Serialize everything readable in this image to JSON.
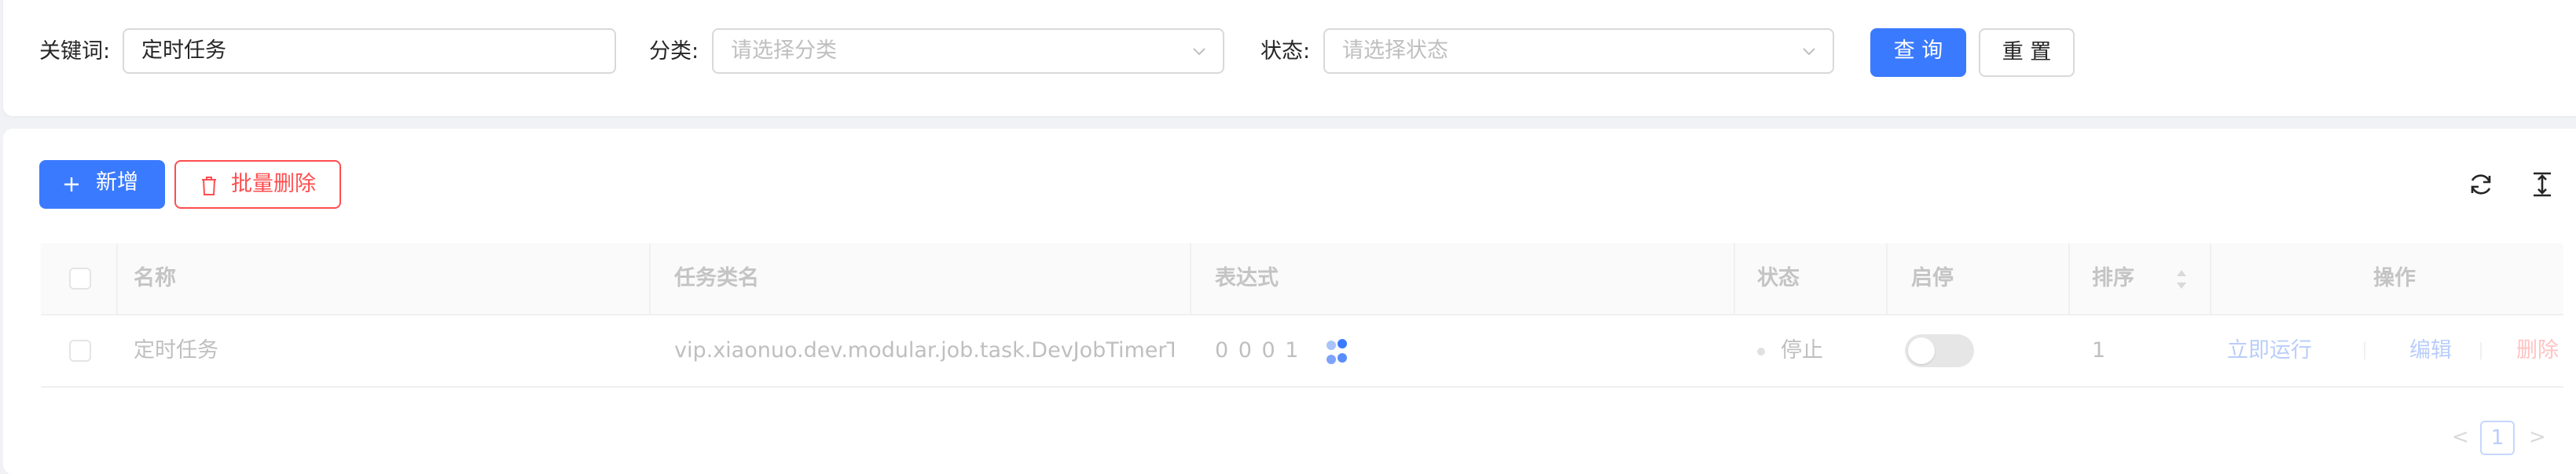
{
  "search": {
    "keyword_label": "关键词:",
    "keyword_value": "定时任务",
    "category_label": "分类:",
    "category_placeholder": "请选择分类",
    "status_label": "状态:",
    "status_placeholder": "请选择状态",
    "query_button": "查 询",
    "reset_button": "重 置"
  },
  "toolbar": {
    "add_button": "新增",
    "batch_delete_button": "批量删除",
    "refresh_icon": "refresh-icon",
    "density_icon": "column-height-icon"
  },
  "table": {
    "headers": [
      "名称",
      "任务类名",
      "表达式",
      "状态",
      "启停",
      "排序",
      "操作"
    ],
    "rows": [
      {
        "name": "定时任务",
        "class_name": "vip.xiaonuo.dev.modular.job.task.DevJobTimerTa...",
        "expression": "0 0 0 1",
        "status": "停止",
        "enabled": false,
        "sort": "1",
        "actions": [
          "立即运行",
          "编辑",
          "删除"
        ]
      }
    ]
  },
  "pagination": {
    "current": "1",
    "prev": "<",
    "next": ">"
  },
  "colors": {
    "primary": "#3a7afe",
    "danger": "#ff4d4f"
  }
}
